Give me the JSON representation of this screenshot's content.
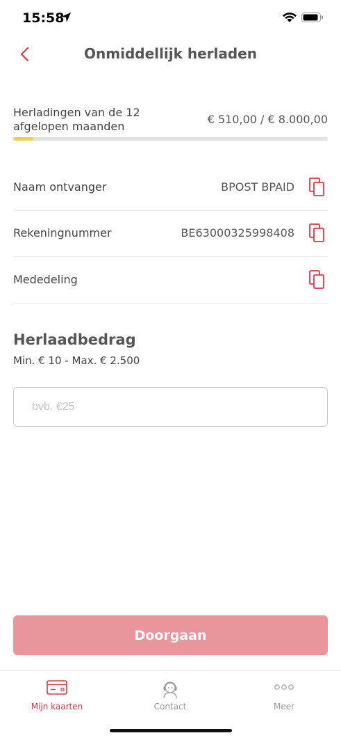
{
  "status_bar": {
    "time": "15:58"
  },
  "nav": {
    "title": "Onmiddellijk herladen"
  },
  "reload_usage": {
    "label_line1": "Herladingen van de 12",
    "label_line2": "afgelopen maanden",
    "value": "€ 510,00 / € 8.000,00",
    "progress_fraction": 0.064
  },
  "details": [
    {
      "label": "Naam ontvanger",
      "value": "BPOST BPAID"
    },
    {
      "label": "Rekeningnummer",
      "value": "BE63000325998408"
    },
    {
      "label": "Mededeling",
      "value": ""
    }
  ],
  "amount": {
    "title": "Herlaadbedrag",
    "limits": "Min. € 10 - Max. € 2.500",
    "placeholder": "bvb. €25",
    "value": ""
  },
  "continue_label": "Doorgaan",
  "tabs": [
    {
      "label": "Mijn kaarten",
      "icon": "card-icon",
      "active": true
    },
    {
      "label": "Contact",
      "icon": "support-agent-icon",
      "active": false
    },
    {
      "label": "Meer",
      "icon": "more-dots-icon",
      "active": false
    }
  ],
  "colors": {
    "accent": "#d83b45",
    "button_disabled": "#e8959b",
    "progress": "#f4cc4a"
  }
}
